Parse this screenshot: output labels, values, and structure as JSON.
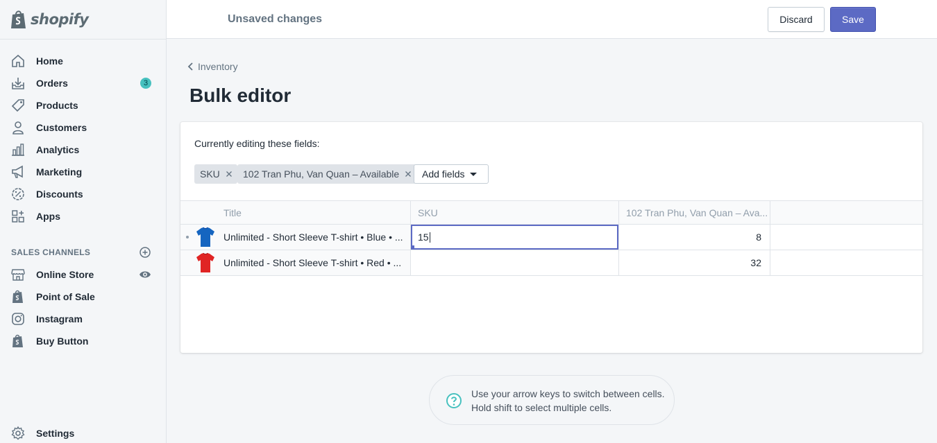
{
  "brand": {
    "name": "shopify"
  },
  "sidebar": {
    "items": [
      {
        "label": "Home",
        "icon": "home-icon"
      },
      {
        "label": "Orders",
        "icon": "orders-icon",
        "badge": "3"
      },
      {
        "label": "Products",
        "icon": "tag-icon"
      },
      {
        "label": "Customers",
        "icon": "person-icon"
      },
      {
        "label": "Analytics",
        "icon": "bar-chart-icon"
      },
      {
        "label": "Marketing",
        "icon": "megaphone-icon"
      },
      {
        "label": "Discounts",
        "icon": "discount-icon"
      },
      {
        "label": "Apps",
        "icon": "apps-icon"
      }
    ],
    "sales_channels_title": "SALES CHANNELS",
    "channels": [
      {
        "label": "Online Store",
        "icon": "store-icon"
      },
      {
        "label": "Point of Sale",
        "icon": "shopify-bag-icon"
      },
      {
        "label": "Instagram",
        "icon": "instagram-icon"
      },
      {
        "label": "Buy Button",
        "icon": "shopify-bag-icon"
      }
    ],
    "settings_label": "Settings"
  },
  "topbar": {
    "title": "Unsaved changes",
    "discard_label": "Discard",
    "save_label": "Save"
  },
  "breadcrumb": {
    "label": "Inventory"
  },
  "page": {
    "title": "Bulk editor"
  },
  "editor": {
    "fields_label": "Currently editing these fields:",
    "tags": [
      "SKU",
      "102 Tran Phu, Van Quan – Available"
    ],
    "add_fields_label": "Add fields",
    "columns": [
      "Title",
      "SKU",
      "102 Tran Phu, Van Quan – Ava..."
    ],
    "rows": [
      {
        "title": "Unlimited - Short Sleeve T-shirt • Blue • ...",
        "sku": "15",
        "available": "8",
        "color": "#1565c0"
      },
      {
        "title": "Unlimited - Short Sleeve T-shirt • Red • ...",
        "sku": "",
        "available": "32",
        "color": "#e02424"
      }
    ]
  },
  "hint": {
    "line1": "Use your arrow keys to switch between cells.",
    "line2": "Hold shift to select multiple cells."
  },
  "colors": {
    "accent": "#5c6ac4",
    "badge": "#47c1bf",
    "teal": "#47c1bf"
  }
}
